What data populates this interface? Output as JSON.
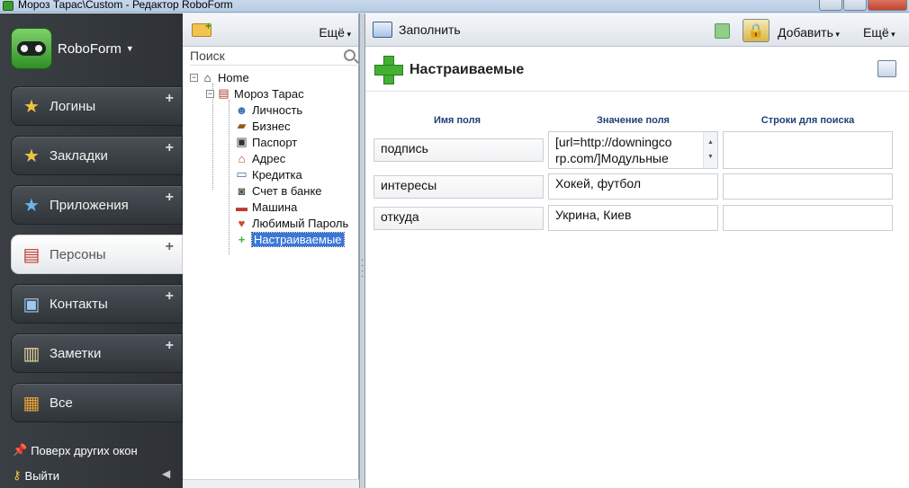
{
  "window": {
    "title": "Мороз Тарас\\Custom - Редактор RoboForm"
  },
  "sidebar": {
    "brand": "RoboForm",
    "items": [
      {
        "label": "Логины",
        "icon": "login-icon",
        "active": false
      },
      {
        "label": "Закладки",
        "icon": "bookmark-star-icon",
        "active": false
      },
      {
        "label": "Приложения",
        "icon": "apps-star-icon",
        "active": false
      },
      {
        "label": "Персоны",
        "icon": "identity-card-icon",
        "active": true
      },
      {
        "label": "Контакты",
        "icon": "contacts-icon",
        "active": false
      },
      {
        "label": "Заметки",
        "icon": "notepad-icon",
        "active": false
      },
      {
        "label": "Все",
        "icon": "all-items-icon",
        "active": false
      }
    ],
    "always_on_top": "Поверх других окон",
    "logout": "Выйти"
  },
  "tree_pane": {
    "more_label": "Ещё",
    "search_placeholder": "Поиск",
    "nodes": [
      {
        "label": "Home",
        "icon": "home-icon"
      },
      {
        "label": "Мороз Тарас",
        "icon": "identity-icon"
      },
      {
        "label": "Личность",
        "icon": "person-icon"
      },
      {
        "label": "Бизнес",
        "icon": "briefcase-icon"
      },
      {
        "label": "Паспорт",
        "icon": "passport-icon"
      },
      {
        "label": "Адрес",
        "icon": "house-icon"
      },
      {
        "label": "Кредитка",
        "icon": "credit-card-icon"
      },
      {
        "label": "Счет в банке",
        "icon": "bank-safe-icon"
      },
      {
        "label": "Машина",
        "icon": "car-icon"
      },
      {
        "label": "Любимый Пароль",
        "icon": "heart-key-icon"
      },
      {
        "label": "Настраиваемые",
        "icon": "plus-icon",
        "selected": true
      }
    ]
  },
  "toolbar": {
    "fill_label": "Заполнить",
    "add_label": "Добавить",
    "more_label": "Ещё"
  },
  "page": {
    "title": "Настраиваемые",
    "columns": [
      "Имя поля",
      "Значение поля",
      "Строки для поиска"
    ],
    "rows": [
      {
        "name": "подпись",
        "value": "[url=http://downingcorp.com/]Модульные",
        "value_line1": "[url=http://downingco",
        "value_line2": "rp.com/]Модульные",
        "search": ""
      },
      {
        "name": "интересы",
        "value": "Хокей, футбол",
        "search": ""
      },
      {
        "name": "откуда",
        "value": "Укрина, Киев",
        "search": ""
      }
    ]
  },
  "colors": {
    "sidebar_bg": "#33383c",
    "accent_green": "#42b132",
    "selection_blue": "#3b78d6",
    "header_text": "#1f3f77"
  }
}
